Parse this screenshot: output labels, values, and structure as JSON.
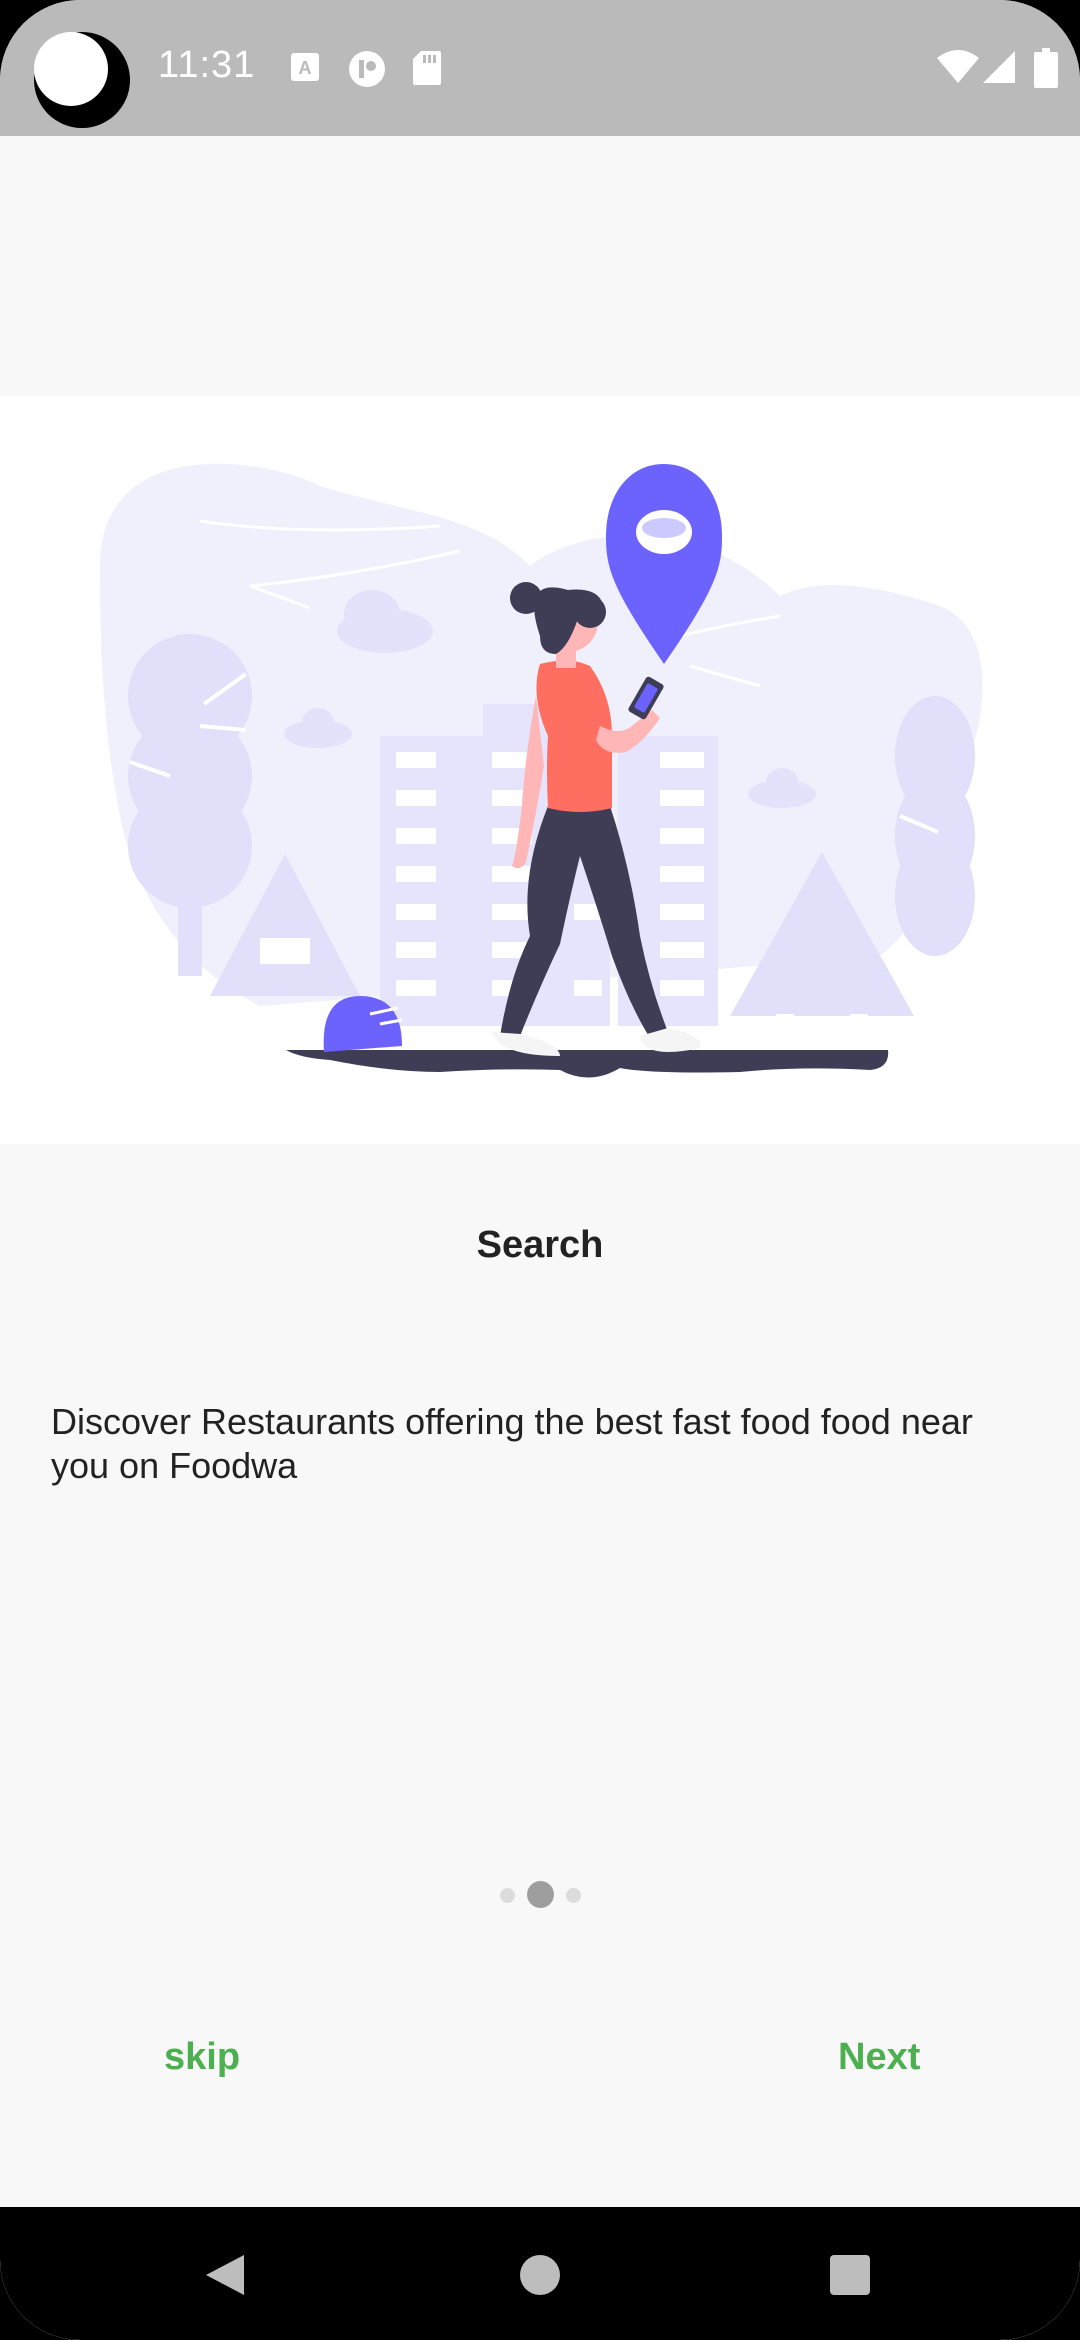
{
  "status_bar": {
    "time": "11:31"
  },
  "onboarding": {
    "title": "Search",
    "description": "Discover Restaurants offering the best fast food food near you on Foodwa",
    "page_indicator": {
      "pages": 3,
      "active_index": 1
    },
    "skip_label": "skip",
    "next_label": "Next"
  },
  "colors": {
    "accent": "#4caf50",
    "illustration_primary": "#6c63ff",
    "background": "#f8f8f8"
  },
  "icons": [
    "font-icon",
    "app-icon",
    "sd-card-icon",
    "wifi-icon",
    "cell-signal-icon",
    "battery-icon",
    "back-icon",
    "home-icon",
    "recents-icon"
  ]
}
